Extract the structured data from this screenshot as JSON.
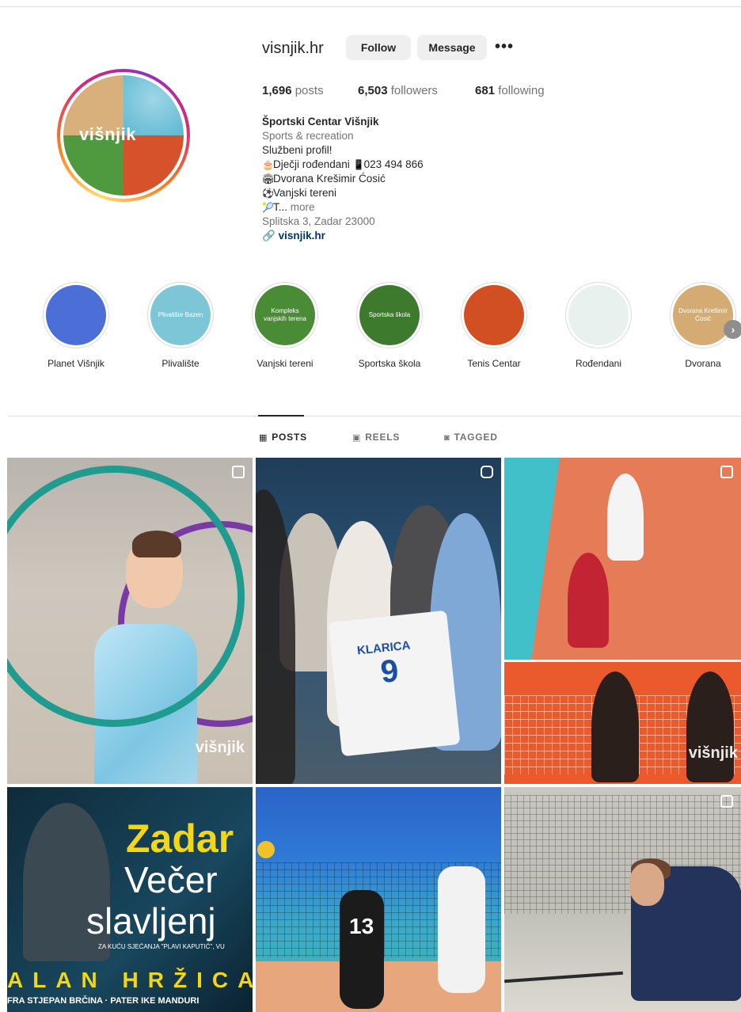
{
  "profile": {
    "username": "visnjik.hr",
    "avatar_text": "višnjik",
    "follow_label": "Follow",
    "message_label": "Message",
    "more_label": "•••"
  },
  "stats": {
    "posts_count": "1,696",
    "posts_label": "posts",
    "followers_count": "6,503",
    "followers_label": "followers",
    "following_count": "681",
    "following_label": "following"
  },
  "bio": {
    "name": "Športski Centar Višnjik",
    "category": "Sports & recreation",
    "line1": "Službeni profil!",
    "line2": "Dječji rođendani",
    "line2_phone": "023 494 866",
    "line3": "Dvorana Krešimir Ćosić",
    "line4": "Vanjski tereni",
    "line5": "T...",
    "more_label": "more",
    "address": "Splitska 3, Zadar 23000",
    "link": "visnjik.hr"
  },
  "highlights": [
    {
      "label": "Planet Višnjik",
      "inner": "",
      "color": "#4b6fd6"
    },
    {
      "label": "Plivalište",
      "inner": "Plivalište Bazen",
      "color": "#7cc6d8"
    },
    {
      "label": "Vanjski tereni",
      "inner": "Kompleks vanjskih terena",
      "color": "#4a8b35"
    },
    {
      "label": "Sportska škola",
      "inner": "Sportska škola",
      "color": "#3e7a2e"
    },
    {
      "label": "Tenis Centar",
      "inner": "",
      "color": "#d14f22"
    },
    {
      "label": "Rođendani",
      "inner": "",
      "color": "#e8f1ee"
    },
    {
      "label": "Dvorana",
      "inner": "Dvorana Krešimir Ćosić",
      "color": "#d5ab74"
    }
  ],
  "tabs": {
    "posts": "POSTS",
    "reels": "REELS",
    "tagged": "TAGGED"
  },
  "posts": {
    "p1_watermark": "višnjik",
    "p2_jersey_name": "KLARICA",
    "p2_jersey_number": "9",
    "p3_watermark": "višnjik",
    "p4_title1": "Zadar",
    "p4_title2": "Večer",
    "p4_title3": "slavljenj",
    "p4_small": "ZA KUĆU SJEĆANJA \"PLAVI KAPUTIĆ\", VU",
    "p4_name": "ALAN HRŽICA",
    "p4_sub": "FRA STJEPAN BRČINA · PATER IKE MANDURI",
    "p5_number": "13"
  },
  "colors": {
    "text": "#262626",
    "muted": "#737373",
    "link": "#00376b",
    "button_bg": "#efefef",
    "divider": "#dbdbdb"
  }
}
